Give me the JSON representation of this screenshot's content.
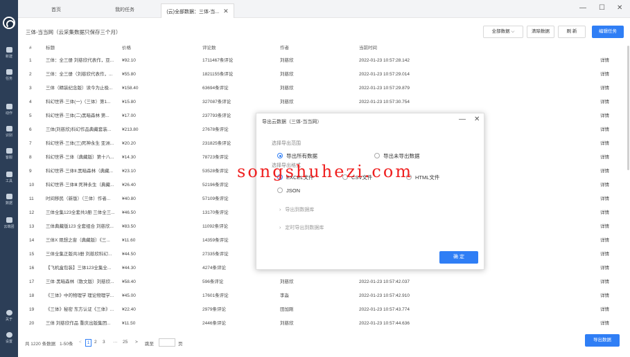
{
  "sidebar": {
    "items": [
      {
        "label": "新建"
      },
      {
        "label": "任务"
      },
      {
        "label": "动作"
      },
      {
        "label": "识别"
      },
      {
        "label": "客服"
      },
      {
        "label": "工具"
      },
      {
        "label": "数据"
      },
      {
        "label": "云端团"
      },
      {
        "label": "关于"
      },
      {
        "label": "设置"
      }
    ]
  },
  "tabs": [
    {
      "label": "首页"
    },
    {
      "label": "我的任务"
    },
    {
      "label": "(云)全部数据：三体-当..."
    }
  ],
  "tab_close": "✕",
  "window_controls": {
    "minimize": "—",
    "maximize": "☐",
    "close": "✕"
  },
  "task": {
    "title": "三体-当当网（云采集数据只保存三个月）"
  },
  "toolbar": {
    "filter": "全部数据",
    "clear": "清除数据",
    "refresh": "刷 新",
    "edit": "编辑任务"
  },
  "table": {
    "headers": [
      "#",
      "标题",
      "价格",
      "评论数",
      "作者",
      "当前时间"
    ],
    "rows": [
      [
        "1",
        "三体：全三册 刘慈欣代表作，亚...",
        "¥92.10",
        "1711467条评论",
        "刘慈欣",
        "2022-01-23 10:57:28.142",
        "详情"
      ],
      [
        "2",
        "三体：全三册（刘慈欣代表作，...",
        "¥55.80",
        "1821155条评论",
        "刘慈欣",
        "2022-01-23 10:57:29.014",
        "详情"
      ],
      [
        "3",
        "三体（精装纪念版）读今为止极...",
        "¥158.40",
        "63694条评论",
        "刘慈欣",
        "2022-01-23 10:57:29.879",
        "详情"
      ],
      [
        "4",
        "科幻世界·三体(一)（三体）第1...",
        "¥15.80",
        "327087条评论",
        "刘慈欣",
        "2022-01-23 10:57:30.754",
        "详情"
      ],
      [
        "5",
        "科幻世界·三体(二)黑暗森林 第...",
        "¥17.00",
        "237793条评论",
        "",
        "",
        "详情"
      ],
      [
        "6",
        "三体(刘慈欣)科幻作品典藏套装...",
        "¥213.80",
        "27678条评论",
        "",
        "",
        "详情"
      ],
      [
        "7",
        "科幻世界·三体(三)死神永生 亚洲...",
        "¥20.20",
        "231825条评论",
        "",
        "",
        "详情"
      ],
      [
        "8",
        "科幻世界·三体（典藏版）第十八...",
        "¥14.30",
        "78723条评论",
        "",
        "",
        "详情"
      ],
      [
        "9",
        "科幻世界·三体Ⅱ:黑暗森林（典藏...",
        "¥23.10",
        "53528条评论",
        "",
        "",
        "详情"
      ],
      [
        "10",
        "科幻世界·三体Ⅲ:死神永生（典藏...",
        "¥26.40",
        "52196条评论",
        "",
        "",
        "详情"
      ],
      [
        "11",
        "时间移民（新版）（三体）作者...",
        "¥40.80",
        "57109条评论",
        "",
        "",
        "详情"
      ],
      [
        "12",
        "三体全集123全套共3册 三体全三...",
        "¥46.50",
        "13170条评论",
        "",
        "",
        "详情"
      ],
      [
        "13",
        "三体典藏版123 全套组合 刘慈欣...",
        "¥83.50",
        "11092条评论",
        "",
        "",
        "详情"
      ],
      [
        "14",
        "三体X 观想之宙（典藏版）《三...",
        "¥11.60",
        "14359条评论",
        "",
        "",
        "详情"
      ],
      [
        "15",
        "三体全集正版共3册 刘慈欣科幻...",
        "¥44.50",
        "27335条评论",
        "",
        "",
        "详情"
      ],
      [
        "16",
        "【飞机盒包装】三体123全集全...",
        "¥44.30",
        "4274条评论",
        "",
        "",
        "详情"
      ],
      [
        "17",
        "三体·黑暗森林（散文版）刘慈欣...",
        "¥58.40",
        "596条评论",
        "刘慈欣",
        "2022-01-23 10:57:42.037",
        "详情"
      ],
      [
        "18",
        "《三体》中的物理学 理论物理学...",
        "¥45.00",
        "17601条评论",
        "李淼",
        "2022-01-23 10:57:42.910",
        "详情"
      ],
      [
        "19",
        "《三体》秘密 东方认证《三体》...",
        "¥22.40",
        "2979条评论",
        "田加刚",
        "2022-01-23 10:57:43.774",
        "详情"
      ],
      [
        "20",
        "三体 刘慈欣作品 重庆出版集团...",
        "¥11.50",
        "2446条评论",
        "刘慈欣",
        "2022-01-23 10:57:44.636",
        "详情"
      ]
    ]
  },
  "footer": {
    "total": "共 1220 条数据",
    "range": "1-50条",
    "prev": "<",
    "pages": [
      "1",
      "2",
      "3",
      "···",
      "25"
    ],
    "next": ">",
    "goto": "跳至",
    "page_unit": "页",
    "export": "导出数据"
  },
  "modal": {
    "title": "导出云数据（三体-当当网）",
    "min": "—",
    "close": "✕",
    "scope_label": "选择导出范围",
    "scope_options": [
      "导出所有数据",
      "导出未导出数据"
    ],
    "format_label": "选择导出格式",
    "format_options": [
      "EXCEL文件",
      "CSV文件",
      "HTML文件",
      "JSON"
    ],
    "expand1": "导出到数据库",
    "expand2": "定时导出到数据库",
    "ok": "确 定"
  },
  "watermark": "songshuhezi.com",
  "colors": {
    "accent": "#2f7ef5",
    "sidebar": "#2c3e57",
    "watermark": "#ef2020"
  }
}
